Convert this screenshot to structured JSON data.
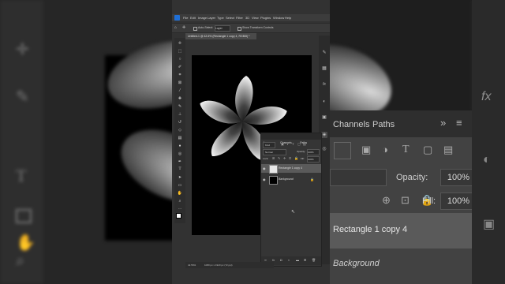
{
  "menu": {
    "items": [
      "File",
      "Edit",
      "Image",
      "Layer",
      "Type",
      "Select",
      "Filter",
      "3D",
      "View",
      "Plugins",
      "Window",
      "Help"
    ]
  },
  "options": {
    "auto_select": "Auto-Select:",
    "auto_select_value": "Layer",
    "show_transform": "Show Transform Controls"
  },
  "document": {
    "tab_title": "Untitled-1 @ 42.6% (Rectangle 1 copy 4, RGB/8) *"
  },
  "status": {
    "zoom": "42.56%",
    "doc_info": "1080 px x 1920 px (72 ppi)"
  },
  "layers_panel": {
    "tabs": [
      "Layers",
      "Channels",
      "Paths"
    ],
    "kind": "Kind",
    "blend_mode": "Normal",
    "opacity_label": "Opacity:",
    "opacity_value": "100%",
    "lock_label": "Lock:",
    "fill_label": "Fill:",
    "fill_value": "100%",
    "layers": [
      {
        "name": "Rectangle 1 copy 4",
        "selected": true
      },
      {
        "name": "Background",
        "selected": false
      }
    ]
  },
  "zoomed_panel": {
    "tab_channels": "Channels",
    "tab_paths": "Paths",
    "opacity_label": "Opacity:",
    "opacity_value": "100%",
    "fill_label": "Fill:",
    "fill_value": "100%",
    "layer_selected": "Rectangle 1 copy 4",
    "layer_background": "Background",
    "fx_label": "fx"
  },
  "colors": {
    "app_bg": "#323232",
    "panel_bg": "#353535",
    "selected_layer": "#5a5a5a",
    "canvas": "#000000"
  }
}
